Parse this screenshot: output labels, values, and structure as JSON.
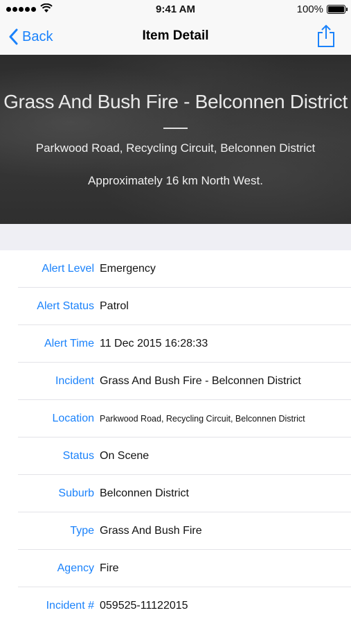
{
  "status_bar": {
    "time": "9:41 AM",
    "battery": "100%",
    "signal_icon": "signal-dots-icon",
    "wifi_icon": "wifi-icon"
  },
  "nav": {
    "back_label": "Back",
    "title": "Item Detail",
    "share_icon": "share-icon",
    "accent_color": "#1a82fb"
  },
  "hero": {
    "title": "Grass And Bush Fire - Belconnen District",
    "location": "Parkwood Road, Recycling Circuit, Belconnen District",
    "distance": "Approximately 16 km North West."
  },
  "details": [
    {
      "label": "Alert Level",
      "value": "Emergency"
    },
    {
      "label": "Alert Status",
      "value": "Patrol"
    },
    {
      "label": "Alert Time",
      "value": "11 Dec 2015 16:28:33"
    },
    {
      "label": "Incident",
      "value": "Grass And Bush Fire - Belconnen District"
    },
    {
      "label": "Location",
      "value": "Parkwood Road, Recycling Circuit, Belconnen District"
    },
    {
      "label": "Status",
      "value": "On Scene"
    },
    {
      "label": "Suburb",
      "value": "Belconnen District"
    },
    {
      "label": "Type",
      "value": "Grass And Bush Fire"
    },
    {
      "label": "Agency",
      "value": "Fire"
    },
    {
      "label": "Incident #",
      "value": "059525-11122015"
    }
  ]
}
